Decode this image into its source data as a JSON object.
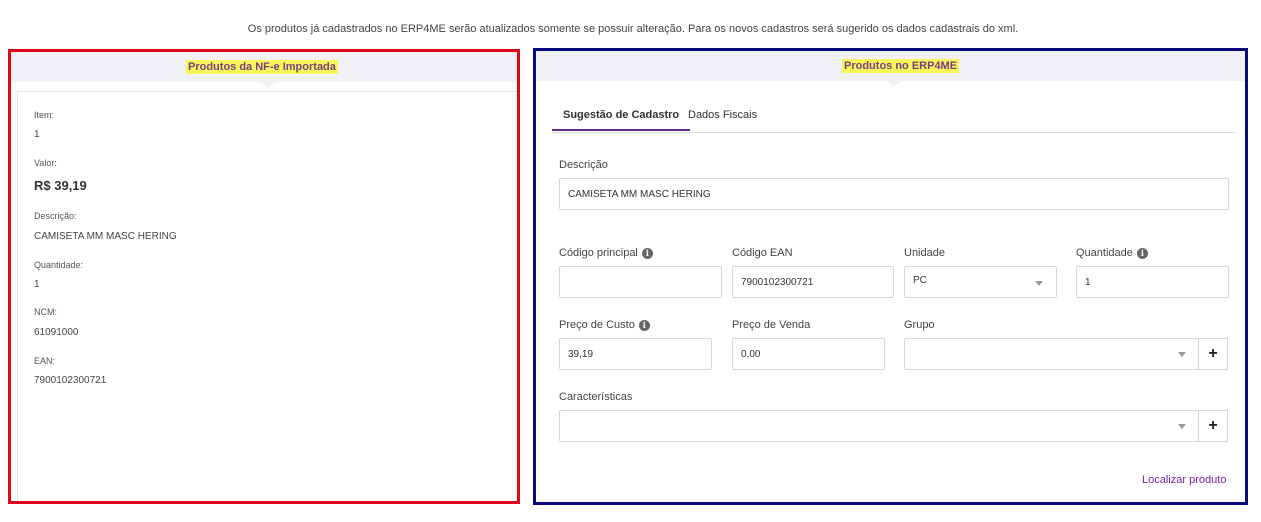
{
  "notice": "Os produtos já cadastrados no ERP4ME serão atualizados somente se possuir alteração. Para os novos cadastros será sugerido os dados cadastrais do xml.",
  "left": {
    "title": "Produtos da NF-e Importada",
    "fields": [
      {
        "label": "Item:",
        "value": "1"
      },
      {
        "label": "Valor:",
        "value": "R$ 39,19"
      },
      {
        "label": "Descrição:",
        "value": "CAMISETA MM MASC HERING"
      },
      {
        "label": "Quantidade:",
        "value": "1"
      },
      {
        "label": "NCM:",
        "value": "61091000"
      },
      {
        "label": "EAN:",
        "value": "7900102300721"
      }
    ]
  },
  "right": {
    "title": "Produtos no ERP4ME",
    "tabs": [
      {
        "label": "Sugestão de Cadastro",
        "active": true
      },
      {
        "label": "Dados Fiscais",
        "active": false
      }
    ],
    "form": {
      "descricao_label": "Descrição",
      "descricao_value": "CAMISETA MM MASC HERING",
      "codigo_principal_label": "Código principal",
      "codigo_principal_value": "",
      "codigo_ean_label": "Código EAN",
      "codigo_ean_value": "7900102300721",
      "unidade_label": "Unidade",
      "unidade_value": "PC",
      "quantidade_label": "Quantidade",
      "quantidade_value": "1",
      "preco_custo_label": "Preço de Custo",
      "preco_custo_value": "39,19",
      "preco_venda_label": "Preço de Venda",
      "preco_venda_value": "0,00",
      "grupo_label": "Grupo",
      "grupo_value": "",
      "caracteristicas_label": "Características",
      "caracteristicas_value": "",
      "add_symbol": "+",
      "info_symbol": "i"
    },
    "localizar_link": "Localizar produto"
  },
  "colors": {
    "left_border": "#e0061a",
    "right_border": "#0a0a80",
    "title_highlight": "#f7f75a",
    "accent": "#7b1fa2"
  },
  "icons": [
    "info-icon",
    "chevron-down-icon",
    "plus-icon"
  ]
}
